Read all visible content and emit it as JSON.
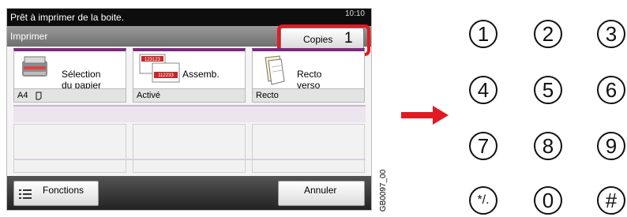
{
  "status_message": "Prêt à imprimer de la boite.",
  "clock": "10:10",
  "screen_title": "Imprimer",
  "copies": {
    "label": "Copies",
    "value": "1"
  },
  "functions": [
    {
      "name_line1": "Sélection",
      "name_line2": "du papier",
      "value": "A4"
    },
    {
      "name_line1": "Assemb.",
      "name_line2": "",
      "value": "Activé"
    },
    {
      "name_line1": "Recto",
      "name_line2": "verso",
      "value": "Recto"
    }
  ],
  "collate_icon_labels": [
    "123123",
    "112233"
  ],
  "bottom": {
    "functions_label": "Fonctions",
    "cancel_label": "Annuler"
  },
  "figure_code": "GB0097_00",
  "keypad": [
    "1",
    "2",
    "3",
    "4",
    "5",
    "6",
    "7",
    "8",
    "9",
    "*/.",
    "0",
    "#"
  ],
  "colors": {
    "accent": "#e11a22",
    "tab": "#7a2a7a"
  }
}
